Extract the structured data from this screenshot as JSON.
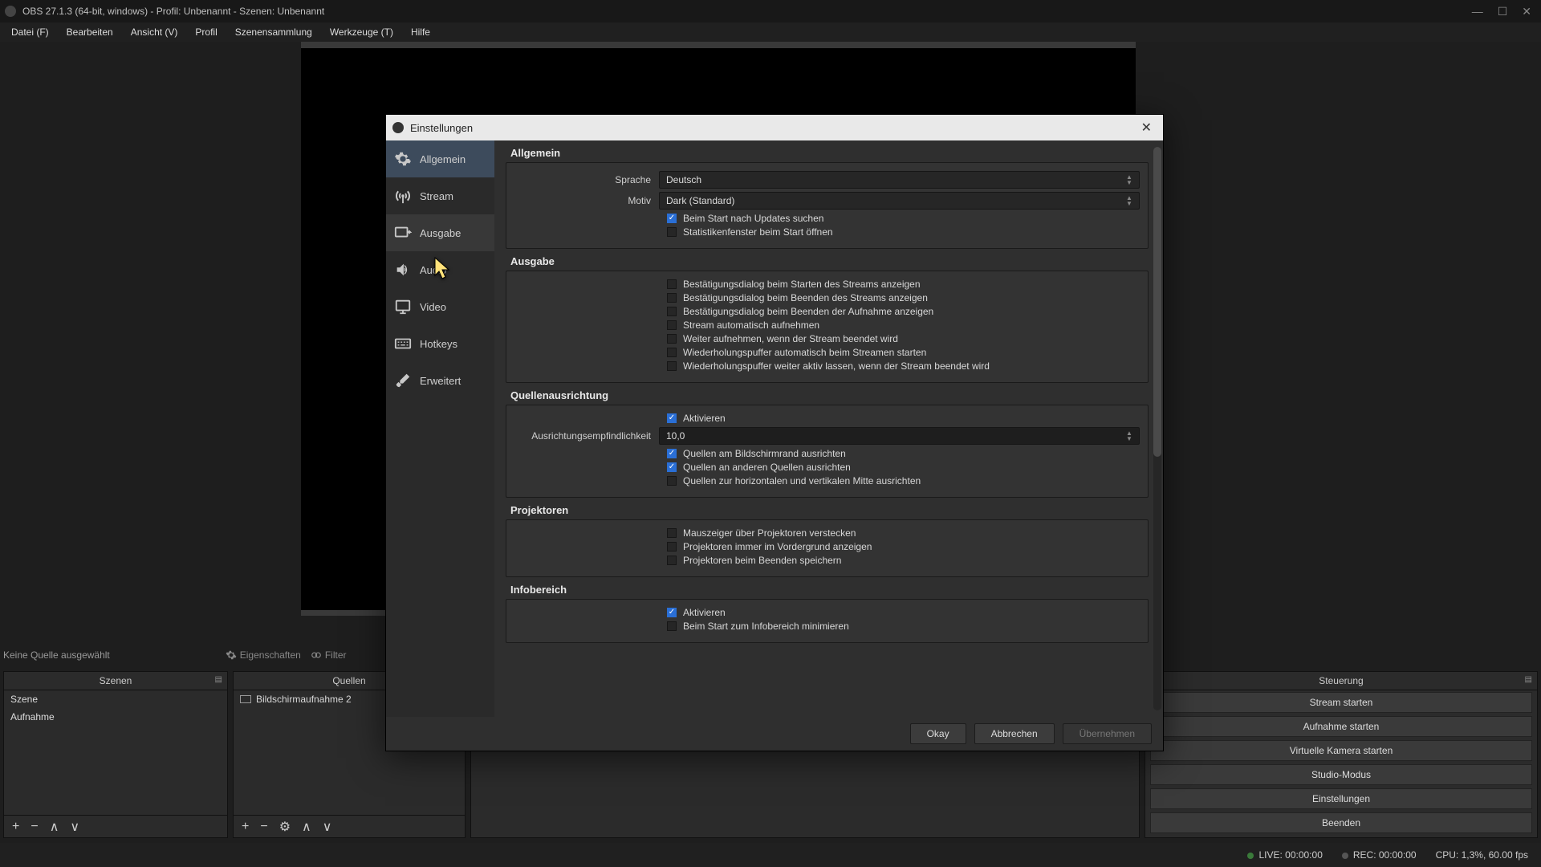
{
  "window_title": "OBS 27.1.3 (64-bit, windows) - Profil: Unbenannt - Szenen: Unbenannt",
  "menubar": [
    "Datei (F)",
    "Bearbeiten",
    "Ansicht (V)",
    "Profil",
    "Szenensammlung",
    "Werkzeuge (T)",
    "Hilfe"
  ],
  "no_source_label": "Keine Quelle ausgewählt",
  "toolbar": {
    "properties": "Eigenschaften",
    "filter": "Filter"
  },
  "docks": {
    "scenes": {
      "title": "Szenen",
      "items": [
        "Szene",
        "Aufnahme"
      ]
    },
    "sources": {
      "title": "Quellen",
      "items": [
        "Bildschirmaufnahme 2"
      ]
    },
    "controls": {
      "title": "Steuerung",
      "buttons": [
        "Stream starten",
        "Aufnahme starten",
        "Virtuelle Kamera starten",
        "Studio-Modus",
        "Einstellungen",
        "Beenden"
      ]
    }
  },
  "status": {
    "live": "LIVE: 00:00:00",
    "rec": "REC: 00:00:00",
    "cpu": "CPU: 1,3%, 60.00 fps"
  },
  "dialog": {
    "title": "Einstellungen",
    "nav": [
      "Allgemein",
      "Stream",
      "Ausgabe",
      "Audio",
      "Video",
      "Hotkeys",
      "Erweitert"
    ],
    "buttons": {
      "ok": "Okay",
      "cancel": "Abbrechen",
      "apply": "Übernehmen"
    },
    "sections": {
      "allgemein": {
        "title": "Allgemein",
        "language_label": "Sprache",
        "language_value": "Deutsch",
        "theme_label": "Motiv",
        "theme_value": "Dark (Standard)",
        "checks": [
          {
            "label": "Beim Start nach Updates suchen",
            "checked": true
          },
          {
            "label": "Statistikenfenster beim Start öffnen",
            "checked": false
          }
        ]
      },
      "ausgabe": {
        "title": "Ausgabe",
        "checks": [
          {
            "label": "Bestätigungsdialog beim Starten des Streams anzeigen",
            "checked": false
          },
          {
            "label": "Bestätigungsdialog beim Beenden des Streams anzeigen",
            "checked": false
          },
          {
            "label": "Bestätigungsdialog beim Beenden der Aufnahme anzeigen",
            "checked": false
          },
          {
            "label": "Stream automatisch aufnehmen",
            "checked": false
          },
          {
            "label": "Weiter aufnehmen, wenn der Stream beendet wird",
            "checked": false
          },
          {
            "label": "Wiederholungspuffer automatisch beim Streamen starten",
            "checked": false
          },
          {
            "label": "Wiederholungspuffer weiter aktiv lassen, wenn der Stream beendet wird",
            "checked": false
          }
        ]
      },
      "snap": {
        "title": "Quellenausrichtung",
        "enable": {
          "label": "Aktivieren",
          "checked": true
        },
        "sens_label": "Ausrichtungsempfindlichkeit",
        "sens_value": "10,0",
        "checks": [
          {
            "label": "Quellen am Bildschirmrand ausrichten",
            "checked": true
          },
          {
            "label": "Quellen an anderen Quellen ausrichten",
            "checked": true
          },
          {
            "label": "Quellen zur horizontalen und vertikalen Mitte ausrichten",
            "checked": false
          }
        ]
      },
      "proj": {
        "title": "Projektoren",
        "checks": [
          {
            "label": "Mauszeiger über Projektoren verstecken",
            "checked": false
          },
          {
            "label": "Projektoren immer im Vordergrund anzeigen",
            "checked": false
          },
          {
            "label": "Projektoren beim Beenden speichern",
            "checked": false
          }
        ]
      },
      "tray": {
        "title": "Infobereich",
        "checks": [
          {
            "label": "Aktivieren",
            "checked": true
          },
          {
            "label": "Beim Start zum Infobereich minimieren",
            "checked": false
          }
        ]
      }
    }
  }
}
